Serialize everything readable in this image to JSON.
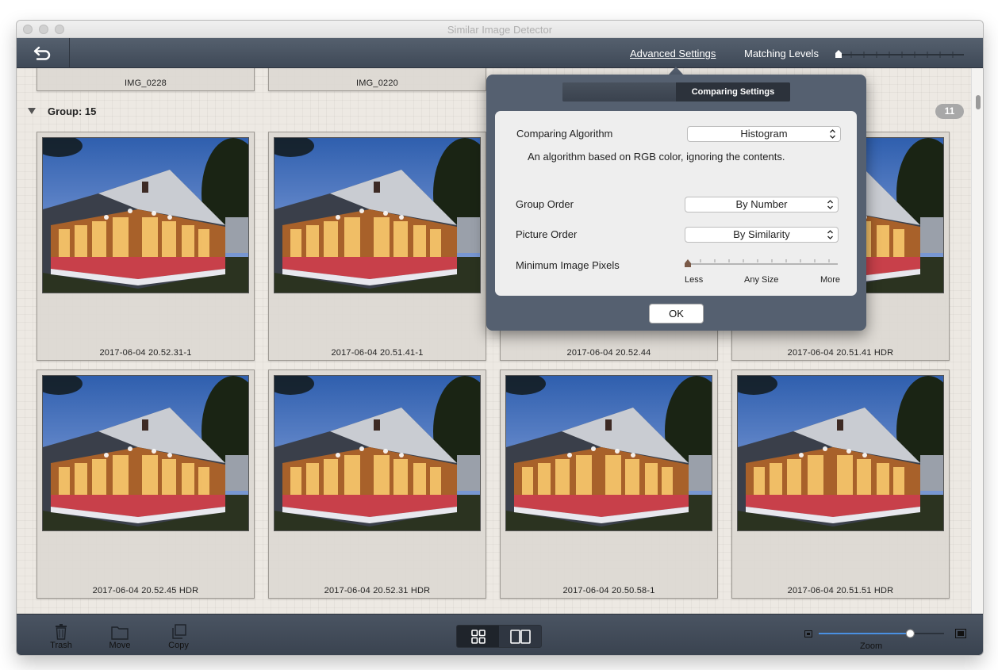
{
  "window": {
    "title": "Similar Image Detector"
  },
  "toolbar": {
    "advanced_settings": "Advanced Settings",
    "matching_levels": "Matching Levels"
  },
  "top_row": [
    {
      "caption": "IMG_0228"
    },
    {
      "caption": "IMG_0220"
    }
  ],
  "group": {
    "label": "Group: 15",
    "count": "11"
  },
  "images": [
    {
      "caption": "2017-06-04 20.52.31-1"
    },
    {
      "caption": "2017-06-04 20.51.41-1"
    },
    {
      "caption": "2017-06-04 20.52.44"
    },
    {
      "caption": "2017-06-04 20.51.41 HDR"
    },
    {
      "caption": "2017-06-04 20.52.45 HDR"
    },
    {
      "caption": "2017-06-04 20.52.31 HDR"
    },
    {
      "caption": "2017-06-04 20.50.58-1"
    },
    {
      "caption": "2017-06-04 20.51.51 HDR"
    }
  ],
  "popover": {
    "tab": "Comparing Settings",
    "algorithm_label": "Comparing Algorithm",
    "algorithm_value": "Histogram",
    "algorithm_desc": "An algorithm based on RGB color, ignoring the contents.",
    "group_order_label": "Group Order",
    "group_order_value": "By Number",
    "picture_order_label": "Picture Order",
    "picture_order_value": "By Similarity",
    "min_pixels_label": "Minimum Image Pixels",
    "min_pixels_level": 0,
    "slider_less": "Less",
    "slider_any": "Any Size",
    "slider_more": "More",
    "ok": "OK"
  },
  "bottombar": {
    "trash": "Trash",
    "move": "Move",
    "copy": "Copy",
    "zoom": "Zoom",
    "zoom_level": 0.73
  },
  "matching_level": 0,
  "icons": {
    "back": "back-arrow-icon",
    "trash": "trash-icon",
    "move": "folder-icon",
    "copy": "copy-icon",
    "grid": "grid-view-icon",
    "compare": "compare-view-icon"
  }
}
